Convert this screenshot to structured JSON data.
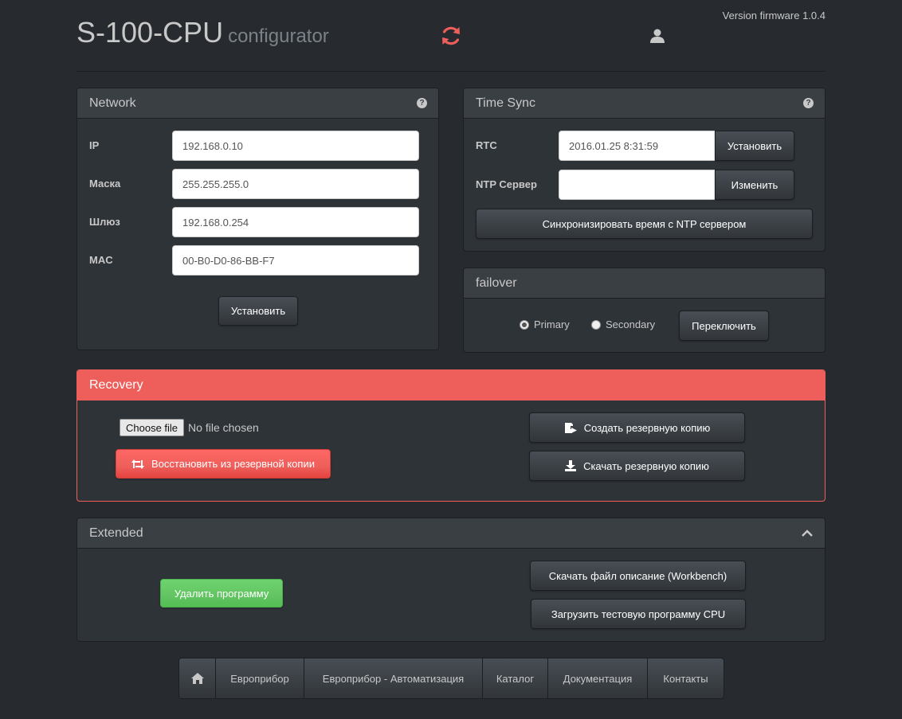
{
  "header": {
    "title": "S-100-CPU",
    "subtitle": "configurator",
    "version": "Version firmware 1.0.4",
    "refresh_icon": "refresh-icon",
    "user_icon": "user-icon"
  },
  "network": {
    "title": "Network",
    "fields": [
      {
        "label": "IP",
        "value": "192.168.0.10"
      },
      {
        "label": "Маска",
        "value": "255.255.255.0"
      },
      {
        "label": "Шлюз",
        "value": "192.168.0.254"
      },
      {
        "label": "MAC",
        "value": "00-B0-D0-86-BB-F7"
      }
    ],
    "set_button": "Установить"
  },
  "time_sync": {
    "title": "Time Sync",
    "rtc_label": "RTC",
    "rtc_value": "2016.01.25 8:31:59",
    "rtc_button": "Установить",
    "ntp_label": "NTP Сервер",
    "ntp_value": "",
    "ntp_button": "Изменить",
    "sync_button": "Синхронизировать время с NTP сервером"
  },
  "failover": {
    "title": "failover",
    "options": [
      {
        "label": "Primary",
        "selected": true
      },
      {
        "label": "Secondary",
        "selected": false
      }
    ],
    "switch_button": "Переключить"
  },
  "recovery": {
    "title": "Recovery",
    "choose_file": "Choose file",
    "no_file": "No file chosen",
    "restore_button": "Восстановить из резервной копии",
    "create_backup_button": "Создать резервную копию",
    "download_backup_button": "Скачать резервную копию",
    "colors": {
      "danger": "#ee5f5b",
      "success": "#62c462"
    }
  },
  "extended": {
    "title": "Extended",
    "delete_button": "Удалить программу",
    "download_desc_button": "Скачать файл описание (Workbench)",
    "load_test_button": "Загрузить тестовую программу CPU"
  },
  "footer": {
    "home_icon": "home-icon",
    "links": [
      "Европрибор",
      "Европрибор - Автоматизация",
      "Каталог",
      "Документация",
      "Контакты"
    ]
  }
}
